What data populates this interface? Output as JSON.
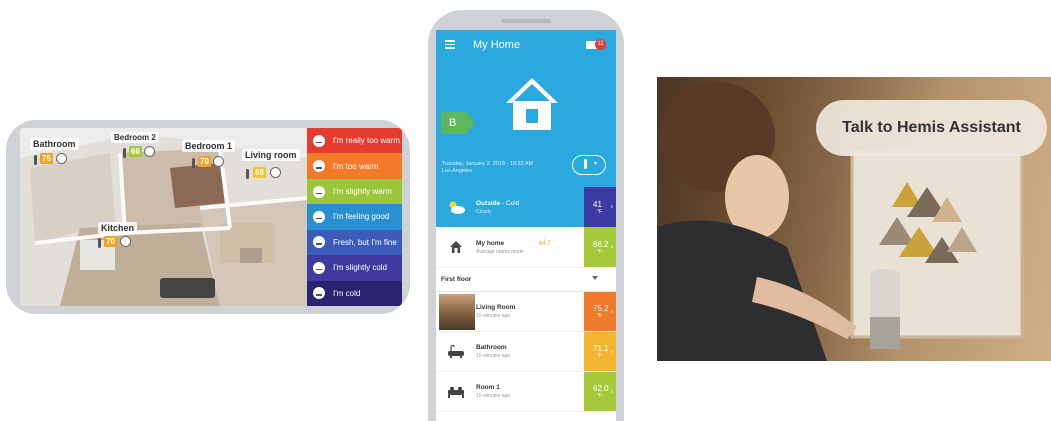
{
  "landscape_app": {
    "rooms": [
      {
        "name": "Bathroom",
        "temp": "75",
        "color": "#f0a52a"
      },
      {
        "name": "Bedroom 2",
        "temp": "66",
        "color": "#a6c93a"
      },
      {
        "name": "Bedroom 1",
        "temp": "70",
        "color": "#f0a52a"
      },
      {
        "name": "Living room",
        "temp": "68",
        "color": "#f6c42a"
      },
      {
        "name": "Kitchen",
        "temp": "70",
        "color": "#f0a52a"
      }
    ],
    "comfort_scale": [
      {
        "label": "I'm really too warm",
        "color": "#e63c2f",
        "icon": "face-hot-icon"
      },
      {
        "label": "I'm too warm",
        "color": "#f47a2a",
        "icon": "face-warm-icon"
      },
      {
        "label": "I'm slightly warm",
        "color": "#9cc63a",
        "icon": "face-slightly-warm-icon"
      },
      {
        "label": "I'm feeling good",
        "color": "#2a8fd0",
        "icon": "face-good-icon"
      },
      {
        "label": "Fresh, but I'm fine",
        "color": "#3a5bb8",
        "icon": "face-fresh-icon"
      },
      {
        "label": "I'm slightly cold",
        "color": "#3e3a9e",
        "icon": "face-slightly-cold-icon"
      },
      {
        "label": "I'm cold",
        "color": "#2a2370",
        "icon": "face-cold-icon"
      }
    ]
  },
  "portrait_app": {
    "title": "My Home",
    "notification_count": "11",
    "energy_class": "B",
    "date": "Tuesday, January 2, 2018 - 10:33 AM",
    "city": "Los Angeles",
    "outside": {
      "name": "Outside",
      "condition": " - Cold",
      "sub": "Cloudy",
      "temp": "41",
      "unit": "°F",
      "color": "#3d3aa1"
    },
    "my_home": {
      "name": "My home",
      "sub": "Average rooms mode",
      "delta": "64.7",
      "temp": "66.2",
      "unit": "°F",
      "color": "#a6c93a"
    },
    "floor": "First floor",
    "rooms": [
      {
        "name": "Living Room",
        "sub": "10 minutes ago",
        "temp": "75.2",
        "unit": "°F",
        "color": "#f07a2a"
      },
      {
        "name": "Bathroom",
        "sub": "10 minutes ago",
        "temp": "71.1",
        "unit": "°F",
        "color": "#f2b530"
      },
      {
        "name": "Room 1",
        "sub": "10 minutes ago",
        "temp": "62.0",
        "unit": "°F",
        "color": "#a6c93a"
      }
    ]
  },
  "photo_panel": {
    "bubble_text": "Talk to Hemis Assistant"
  }
}
